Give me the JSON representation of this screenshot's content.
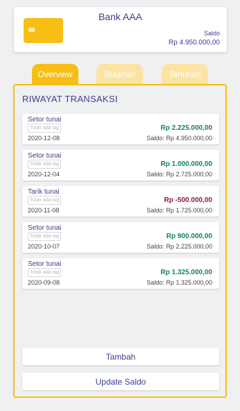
{
  "account": {
    "name": "Bank AAA",
    "saldo_label": "Saldo",
    "saldo_value": "Rp 4.950.000,00"
  },
  "tabs": [
    {
      "label": "Overview",
      "active": true
    },
    {
      "label": "Bulanan",
      "active": false
    },
    {
      "label": "Tahunan",
      "active": false
    }
  ],
  "history": {
    "title": "RIWAYAT TRANSAKSI",
    "transactions": [
      {
        "type": "Setor tunai",
        "tag": "Tidak ada tag",
        "date": "2020-12-08",
        "amount": "Rp 2.225.000,00",
        "balance": "Saldo: Rp 4.950.000,00",
        "positive": true
      },
      {
        "type": "Setor tunai",
        "tag": "Tidak ada tag",
        "date": "2020-12-04",
        "amount": "Rp 1.000.000,00",
        "balance": "Saldo: Rp 2.725.000,00",
        "positive": true
      },
      {
        "type": "Tarik tunai",
        "tag": "Tidak ada tag",
        "date": "2020-11-08",
        "amount": "Rp -500.000,00",
        "balance": "Saldo: Rp 1.725.000,00",
        "positive": false
      },
      {
        "type": "Setor tunai",
        "tag": "Tidak ada tag",
        "date": "2020-10-07",
        "amount": "Rp 900.000,00",
        "balance": "Saldo: Rp 2.225.000,00",
        "positive": true
      },
      {
        "type": "Setor tunai",
        "tag": "Tidak ada tag",
        "date": "2020-09-08",
        "amount": "Rp 1.325.000,00",
        "balance": "Saldo: Rp 1.325.000,00",
        "positive": true
      }
    ]
  },
  "buttons": {
    "add": "Tambah",
    "update": "Update Saldo"
  },
  "colors": {
    "accent": "#f7be16",
    "text": "#3c3e8e",
    "positive": "#13835a",
    "negative": "#8e1a3a"
  },
  "icons": {
    "card": "credit-card-icon"
  }
}
